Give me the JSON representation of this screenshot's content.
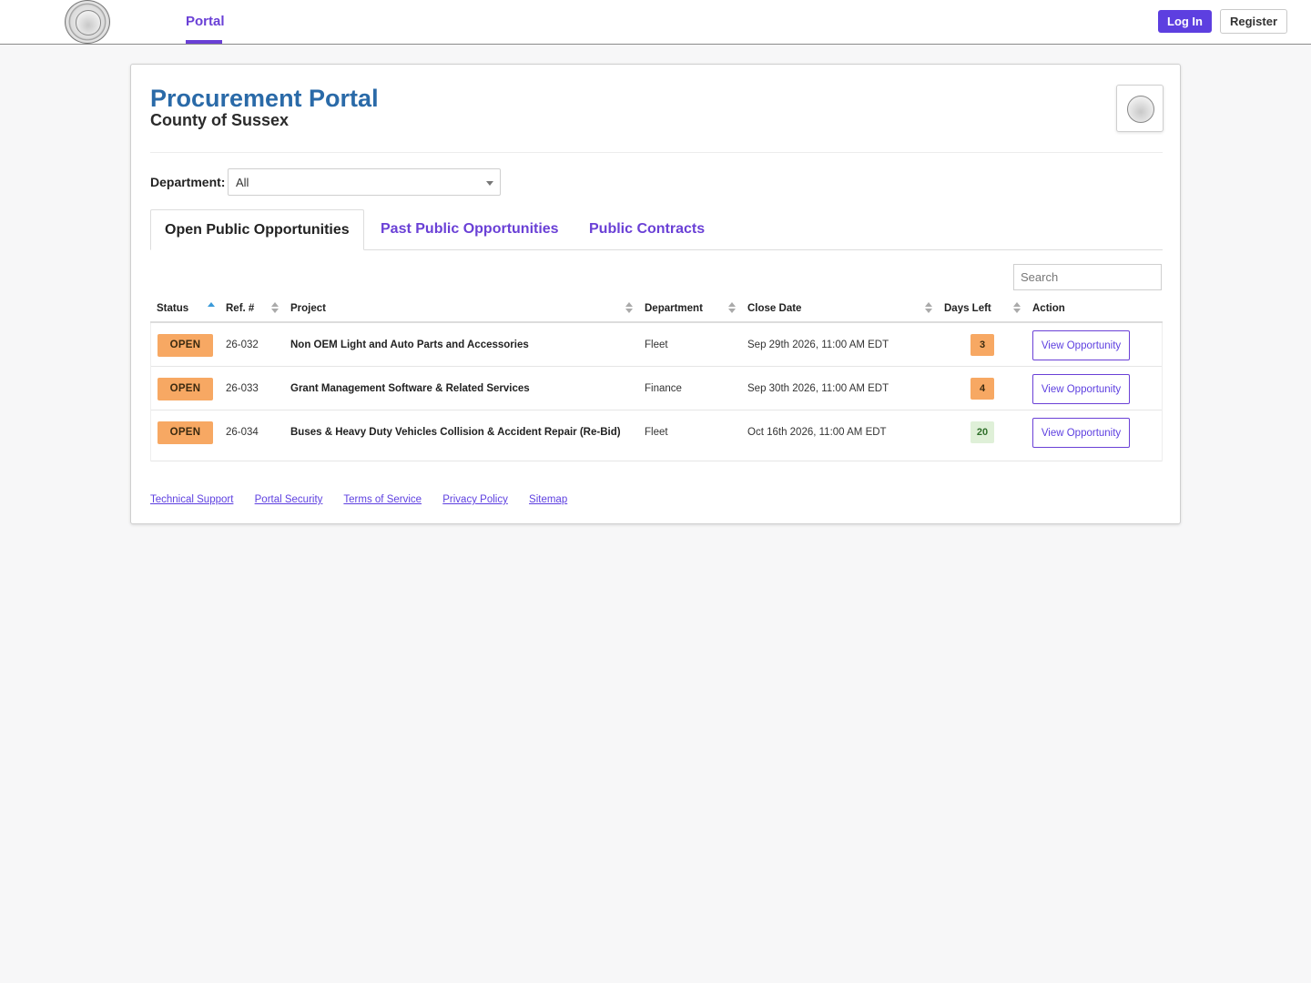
{
  "nav": {
    "portal_label": "Portal",
    "login_label": "Log In",
    "register_label": "Register"
  },
  "header": {
    "title": "Procurement Portal",
    "subtitle": "County of Sussex"
  },
  "filter": {
    "department_label": "Department:",
    "department_value": "All"
  },
  "tabs": [
    {
      "label": "Open Public Opportunities",
      "active": true
    },
    {
      "label": "Past Public Opportunities",
      "active": false
    },
    {
      "label": "Public Contracts",
      "active": false
    }
  ],
  "search": {
    "placeholder": "Search"
  },
  "table": {
    "columns": [
      "Status",
      "Ref. #",
      "Project",
      "Department",
      "Close Date",
      "Days Left",
      "Action"
    ],
    "rows": [
      {
        "status": "OPEN",
        "ref": "26-032",
        "project": "Non OEM Light and Auto Parts and Accessories",
        "department": "Fleet",
        "close_date": "Sep 29th 2026, 11:00 AM EDT",
        "days_left": "3",
        "action": "View Opportunity"
      },
      {
        "status": "OPEN",
        "ref": "26-033",
        "project": "Grant Management Software & Related Services",
        "department": "Finance",
        "close_date": "Sep 30th 2026, 11:00 AM EDT",
        "days_left": "4",
        "action": "View Opportunity"
      },
      {
        "status": "OPEN",
        "ref": "26-034",
        "project": "Buses & Heavy Duty Vehicles Collision & Accident Repair (Re-Bid)",
        "department": "Fleet",
        "close_date": "Oct 16th 2026, 11:00 AM EDT",
        "days_left": "20",
        "action": "View Opportunity"
      }
    ]
  },
  "footer": {
    "links": [
      "Technical Support",
      "Portal Security",
      "Terms of Service",
      "Privacy Policy",
      "Sitemap"
    ]
  },
  "colors": {
    "accent": "#6a40d6",
    "title_blue": "#2a6aa8",
    "status_open": "#f7a863",
    "days_ok": "#dff0d8"
  }
}
